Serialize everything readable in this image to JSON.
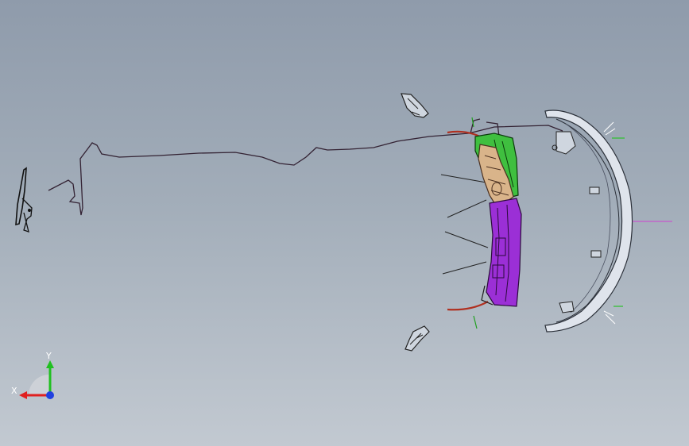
{
  "viewport": {
    "background_top": "#8f9bab",
    "background_bottom": "#c2c9d1"
  },
  "assembly": {
    "parts": [
      {
        "name": "front-bumper-cover",
        "color": "#dfe4ec"
      },
      {
        "name": "upper-grille-bracket",
        "color": "#3fbf3f"
      },
      {
        "name": "lower-grille-bracket",
        "color": "#9b2fd6"
      },
      {
        "name": "center-reinforcement",
        "color": "#d9b48a"
      },
      {
        "name": "wire-harness",
        "color": "#3a2a3a"
      },
      {
        "name": "fog-lamp-upper",
        "color": "#cfd6df"
      },
      {
        "name": "fog-lamp-lower",
        "color": "#cfd6df"
      },
      {
        "name": "side-bracket",
        "color": "#1c1c1c"
      },
      {
        "name": "bumper-trim-strip",
        "color": "#c0392b"
      }
    ]
  },
  "triad": {
    "x_label": "X",
    "y_label": "Y",
    "x_color": "#e02020",
    "y_color": "#20c020",
    "z_color": "#2040e0",
    "icon": "coordinate-triad-icon"
  }
}
